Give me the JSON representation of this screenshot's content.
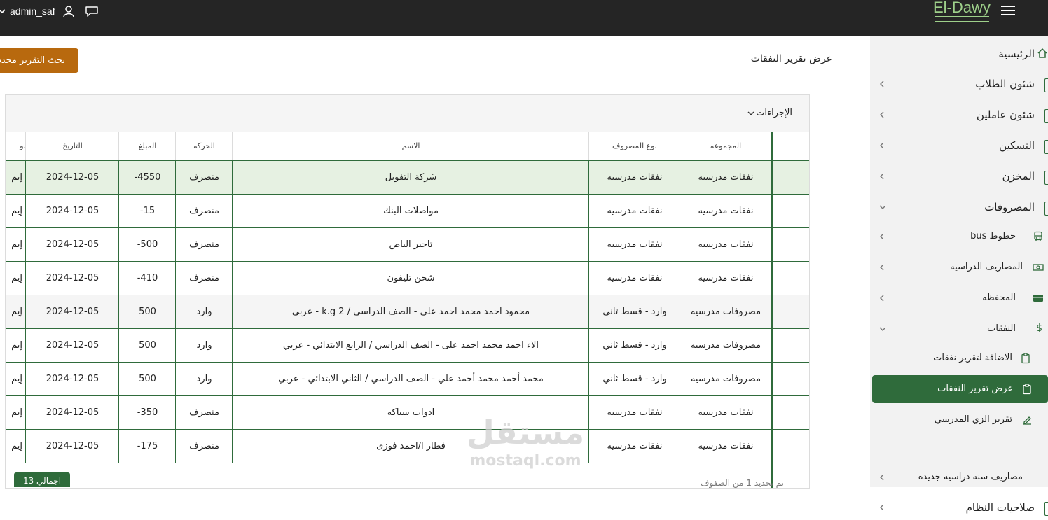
{
  "topbar": {
    "username": "admin_saf",
    "logo_text": "El-Dawy"
  },
  "sidebar": {
    "items": [
      {
        "label": "الرئيسية",
        "icon": "home-icon"
      },
      {
        "label": "شئون الطلاب",
        "icon": "folder-icon"
      },
      {
        "label": "شئون عاملين",
        "icon": "folder-icon"
      },
      {
        "label": "التسكين",
        "icon": "folder-icon"
      },
      {
        "label": "المخزن",
        "icon": "folder-icon"
      },
      {
        "label": "المصروفات",
        "icon": "folder-icon"
      }
    ],
    "subitems": [
      {
        "label": "خطوط bus",
        "icon": "bus-icon"
      },
      {
        "label": "المصاريف الدراسيه",
        "icon": "cash-icon"
      },
      {
        "label": "المحفظه",
        "icon": "wallet-icon"
      },
      {
        "label": "النفقات",
        "icon": "dollar-icon"
      },
      {
        "label": "الاضافة لتقرير نفقات",
        "icon": "clipboard-icon"
      },
      {
        "label": "عرض تقرير النفقات",
        "icon": "clipboard-icon"
      },
      {
        "label": "تقرير الزي المدرسي",
        "icon": "edit-icon"
      },
      {
        "label": "مصاريف سنه دراسيه جديده",
        "icon": ""
      },
      {
        "label": "صلاحيات النظام",
        "icon": ""
      }
    ]
  },
  "main": {
    "title": "عرض تقرير النفقات",
    "report_button": "بحث التقرير محدد",
    "actions_label": "الإجراءات",
    "columns": [
      "المجموعه",
      "نوع المصروف",
      "الاسم",
      "الحركه",
      "المبلغ",
      "التاريخ",
      "بو"
    ],
    "rows": [
      [
        "نفقات مدرسيه",
        "نفقات مدرسيه",
        "شركة التفويل",
        "منصرف",
        "-4550",
        "2024-12-05",
        "إيم"
      ],
      [
        "نفقات مدرسيه",
        "نفقات مدرسيه",
        "مواصلات البنك",
        "منصرف",
        "-15",
        "2024-12-05",
        "إيم"
      ],
      [
        "نفقات مدرسيه",
        "نفقات مدرسيه",
        "تاجير الباص",
        "منصرف",
        "-500",
        "2024-12-05",
        "إيم"
      ],
      [
        "نفقات مدرسيه",
        "نفقات مدرسيه",
        "شحن تليفون",
        "منصرف",
        "-410",
        "2024-12-05",
        "إيم"
      ],
      [
        "مصروفات مدرسيه",
        "وارد - قسط ثاني",
        "محمود احمد محمد احمد على - الصف الدراسي / k.g 2 - عربي",
        "وارد",
        "500",
        "2024-12-05",
        "إيم"
      ],
      [
        "مصروفات مدرسيه",
        "وارد - قسط ثاني",
        "الاء احمد محمد احمد على - الصف الدراسي / الرابع الابتدائي - عربي",
        "وارد",
        "500",
        "2024-12-05",
        "إيم"
      ],
      [
        "مصروفات مدرسيه",
        "وارد - قسط ثاني",
        "محمد أحمد محمد أحمد علي - الصف الدراسي / الثاني الابتدائي - عربي",
        "وارد",
        "500",
        "2024-12-05",
        "إيم"
      ],
      [
        "نفقات مدرسيه",
        "نفقات مدرسيه",
        "ادوات سباكه",
        "منصرف",
        "-350",
        "2024-12-05",
        "إيم"
      ],
      [
        "نفقات مدرسيه",
        "نفقات مدرسيه",
        "فطار ا/احمد فوزى",
        "منصرف",
        "-175",
        "2024-12-05",
        "إيم"
      ]
    ],
    "total_label": "اجمالي 13",
    "footer_text": "تم تحديد 1 من الصفوف"
  },
  "watermark": {
    "line1": "مستقل",
    "line2": "mostaql.com"
  }
}
